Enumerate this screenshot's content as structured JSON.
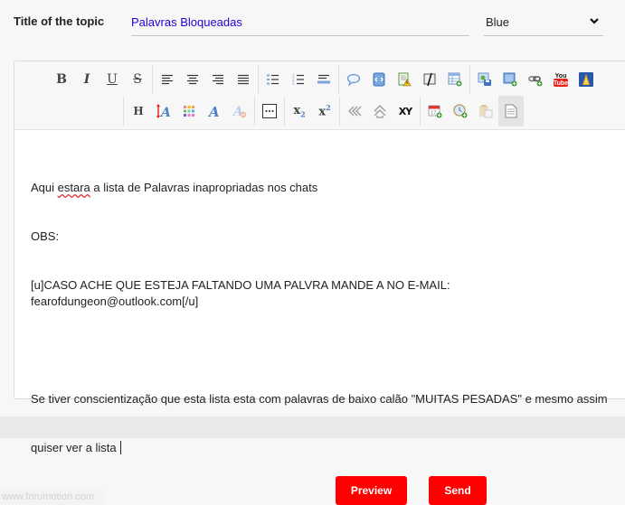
{
  "form": {
    "title_label": "Title of the topic",
    "title_value": "Palavras Bloqueadas",
    "color_select": {
      "selected": "Blue",
      "text_color": "#2200d9"
    }
  },
  "toolbar": {
    "row1": [
      {
        "name": "bold",
        "icon": "bold-icon",
        "glyph": "B"
      },
      {
        "name": "italic",
        "icon": "italic-icon",
        "glyph": "I"
      },
      {
        "name": "underline",
        "icon": "underline-icon",
        "glyph": "U"
      },
      {
        "name": "strikethrough",
        "icon": "strikethrough-icon",
        "glyph": "S"
      },
      {
        "name": "align-left",
        "icon": "align-left-icon"
      },
      {
        "name": "align-center",
        "icon": "align-center-icon"
      },
      {
        "name": "align-right",
        "icon": "align-right-icon"
      },
      {
        "name": "justify",
        "icon": "align-justify-icon"
      },
      {
        "name": "bullet-list",
        "icon": "bullet-list-icon"
      },
      {
        "name": "numbered-list",
        "icon": "numbered-list-icon"
      },
      {
        "name": "horizontal-rule",
        "icon": "horizontal-rule-icon"
      },
      {
        "name": "quote",
        "icon": "quote-icon"
      },
      {
        "name": "code",
        "icon": "code-icon"
      },
      {
        "name": "spoiler",
        "icon": "spoiler-icon"
      },
      {
        "name": "hide",
        "icon": "hide-icon"
      },
      {
        "name": "table",
        "icon": "table-icon"
      },
      {
        "name": "host-image",
        "icon": "host-image-icon"
      },
      {
        "name": "insert-image",
        "icon": "insert-image-icon"
      },
      {
        "name": "insert-link",
        "icon": "link-icon"
      },
      {
        "name": "youtube",
        "icon": "youtube-icon",
        "glyph_top": "You",
        "glyph_bottom": "Tube"
      },
      {
        "name": "flash",
        "icon": "flash-icon"
      }
    ],
    "row2": [
      {
        "name": "heading",
        "icon": "heading-icon",
        "glyph": "H"
      },
      {
        "name": "font-size",
        "icon": "font-size-icon"
      },
      {
        "name": "text-color",
        "icon": "color-palette-icon"
      },
      {
        "name": "font-face",
        "icon": "font-face-icon"
      },
      {
        "name": "remove-format",
        "icon": "remove-format-icon"
      },
      {
        "name": "more",
        "icon": "more-icon"
      },
      {
        "name": "subscript",
        "icon": "subscript-icon",
        "glyph": "x",
        "sub": "2"
      },
      {
        "name": "superscript",
        "icon": "superscript-icon",
        "glyph": "x",
        "sup": "2"
      },
      {
        "name": "scroll",
        "icon": "scroll-icon"
      },
      {
        "name": "updown",
        "icon": "updown-icon"
      },
      {
        "name": "random",
        "icon": "random-icon",
        "glyph": "XY"
      },
      {
        "name": "date",
        "icon": "calendar-icon",
        "glyph": "17"
      },
      {
        "name": "time",
        "icon": "clock-icon"
      },
      {
        "name": "paste",
        "icon": "paste-icon"
      },
      {
        "name": "source",
        "icon": "source-icon",
        "active": true
      }
    ]
  },
  "editor": {
    "lines": [
      {
        "pre": "Aqui ",
        "misspelled": "estara",
        "post": " a lista de Palavras inapropriadas nos chats"
      },
      {
        "text": "OBS:"
      },
      {
        "text": "[u]CASO ACHE QUE ESTEJA FALTANDO UMA PALVRA MANDE A NO E-MAIL: fearofdungeon@outlook.com[/u]"
      },
      {
        "text": ""
      },
      {
        "text": "Se tiver conscientização que esta lista esta com palavras de baixo calão \"MUITAS PESADAS\" e mesmo assim"
      },
      {
        "text": "quiser ver a lista "
      }
    ]
  },
  "actions": {
    "preview_label": "Preview",
    "send_label": "Send",
    "accent_color": "#ff0000"
  },
  "footer": {
    "watermark": "www.forumotion.com"
  }
}
